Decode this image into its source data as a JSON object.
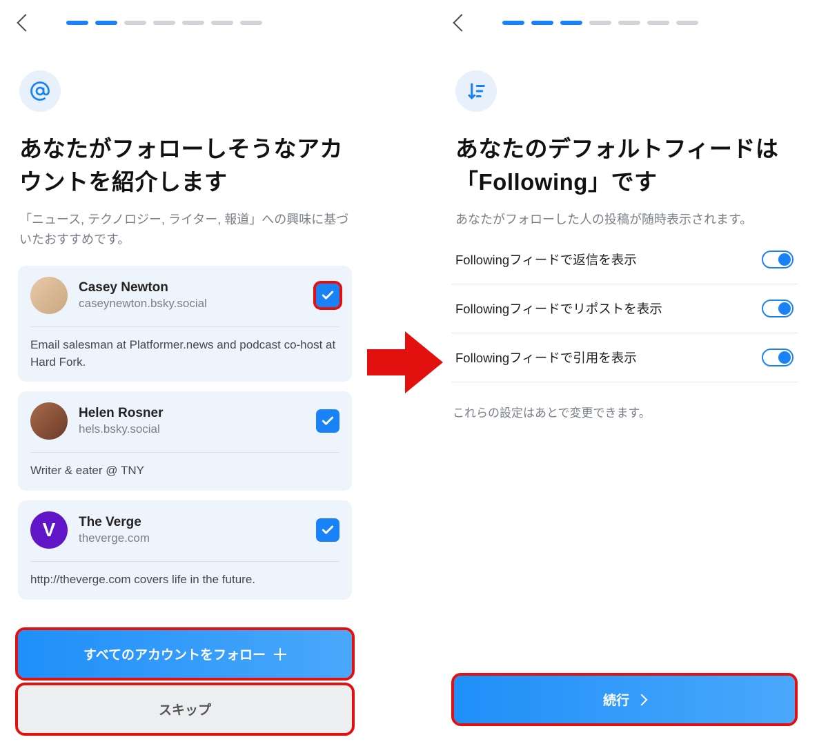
{
  "left": {
    "progress_active": 2,
    "progress_total": 7,
    "title": "あなたがフォローしそうなアカウントを紹介します",
    "subtitle": "「ニュース, テクノロジー, ライター, 報道」への興味に基づいたおすすめです。",
    "accounts": [
      {
        "name": "Casey Newton",
        "handle": "caseynewton.bsky.social",
        "bio": "Email salesman at Platformer.news and podcast co-host at Hard Fork.",
        "highlighted": true
      },
      {
        "name": "Helen Rosner",
        "handle": "hels.bsky.social",
        "bio": "Writer & eater @ TNY",
        "highlighted": false
      },
      {
        "name": "The Verge",
        "handle": "theverge.com",
        "bio": "http://theverge.com covers life in the future.",
        "highlighted": false,
        "avatar_letter": "V"
      }
    ],
    "follow_all_button": "すべてのアカウントをフォロー",
    "skip_button": "スキップ"
  },
  "right": {
    "progress_active": 3,
    "progress_total": 7,
    "title": "あなたのデフォルトフィードは「Following」です",
    "subtitle": "あなたがフォローした人の投稿が随時表示されます。",
    "toggles": [
      {
        "label": "Followingフィードで返信を表示",
        "on": true
      },
      {
        "label": "Followingフィードでリポストを表示",
        "on": true
      },
      {
        "label": "Followingフィードで引用を表示",
        "on": true
      }
    ],
    "note": "これらの設定はあとで変更できます。",
    "continue_button": "続行"
  }
}
